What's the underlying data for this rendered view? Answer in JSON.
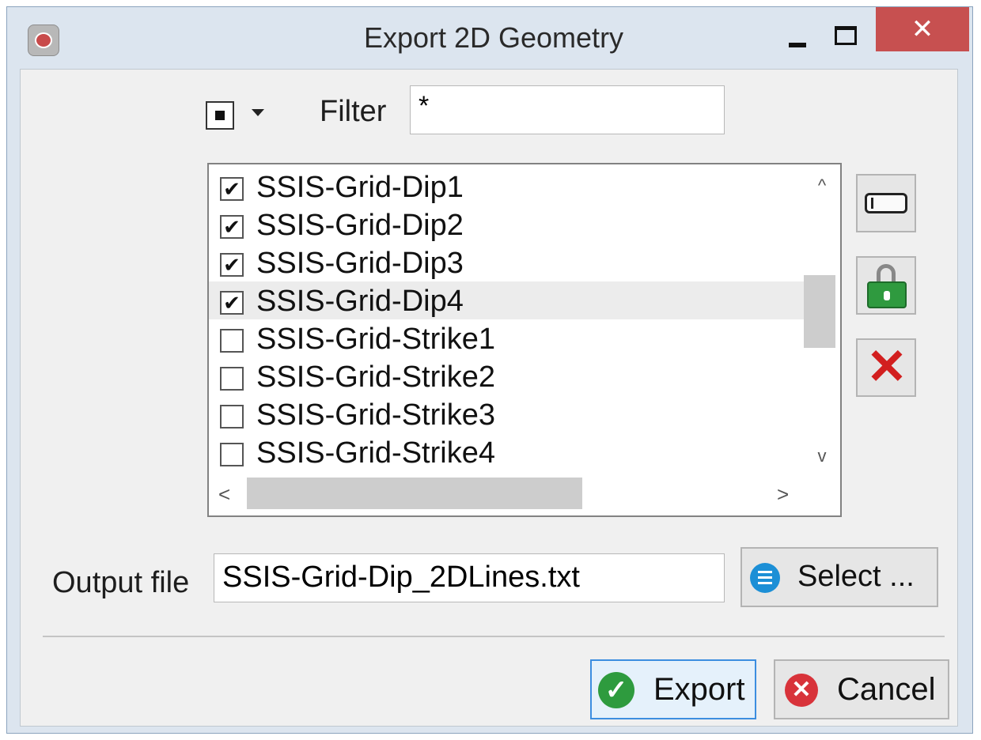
{
  "window": {
    "title": "Export 2D Geometry",
    "close_symbol": "✕"
  },
  "filter": {
    "label": "Filter",
    "value": "*"
  },
  "items": [
    {
      "label": "SSIS-Grid-Dip1",
      "checked": true,
      "mark": "✔"
    },
    {
      "label": "SSIS-Grid-Dip2",
      "checked": true,
      "mark": "✔"
    },
    {
      "label": "SSIS-Grid-Dip3",
      "checked": true,
      "mark": "✔"
    },
    {
      "label": "SSIS-Grid-Dip4",
      "checked": true,
      "mark": "✔"
    },
    {
      "label": "SSIS-Grid-Strike1",
      "checked": false,
      "mark": ""
    },
    {
      "label": "SSIS-Grid-Strike2",
      "checked": false,
      "mark": ""
    },
    {
      "label": "SSIS-Grid-Strike3",
      "checked": false,
      "mark": ""
    },
    {
      "label": "SSIS-Grid-Strike4",
      "checked": false,
      "mark": ""
    }
  ],
  "scroll": {
    "up": "^",
    "down": "v",
    "left": "<",
    "right": ">"
  },
  "output": {
    "label": "Output file",
    "value": "SSIS-Grid-Dip_2DLines.txt",
    "select_label": "Select ..."
  },
  "buttons": {
    "export_label": "Export",
    "cancel_label": "Cancel",
    "export_check": "✓",
    "cancel_x": "✕",
    "delete_x": "✕"
  },
  "icons": {
    "app": "app-logo-icon",
    "toggle": "select-toggle-icon",
    "deselect": "deselect-all-icon",
    "lock": "unlock-icon",
    "delete": "delete-icon",
    "select": "list-icon",
    "export": "check-icon",
    "cancel": "close-icon"
  },
  "colors": {
    "title_bar": "#dce5ef",
    "close_button": "#c75050",
    "export_border": "#3c8ee0",
    "lock_green": "#2f9a3f",
    "delete_red": "#d21f1f"
  }
}
